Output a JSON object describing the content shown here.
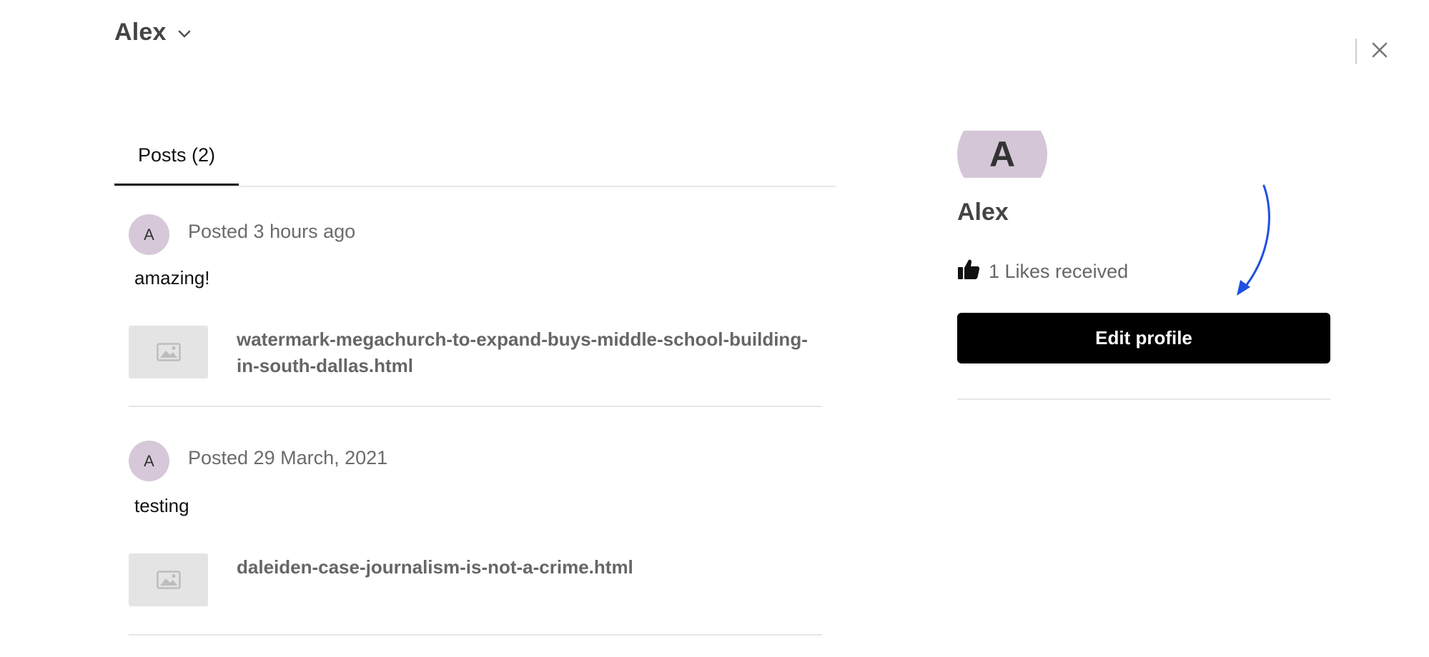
{
  "header": {
    "user_name": "Alex",
    "dropdown_icon": "chevron-down-icon",
    "close_icon": "close-icon"
  },
  "tabs": [
    {
      "label": "Posts (2)",
      "active": true
    }
  ],
  "posts": [
    {
      "avatar_letter": "A",
      "meta": "Posted 3 hours ago",
      "text": "amazing!",
      "attachment": {
        "icon": "image-placeholder-icon",
        "title": "watermark-megachurch-to-expand-buys-middle-school-building-in-south-dallas.html"
      }
    },
    {
      "avatar_letter": "A",
      "meta": "Posted 29 March, 2021",
      "text": "testing",
      "attachment": {
        "icon": "image-placeholder-icon",
        "title": "daleiden-case-journalism-is-not-a-crime.html"
      }
    }
  ],
  "profile": {
    "avatar_letter": "A",
    "name": "Alex",
    "likes_icon": "thumbs-up-icon",
    "likes_text": "1 Likes received",
    "edit_button_label": "Edit profile"
  },
  "colors": {
    "avatar_bg": "#d6c8d9",
    "button_bg": "#000000",
    "annotation_arrow": "#1f4fe0"
  }
}
